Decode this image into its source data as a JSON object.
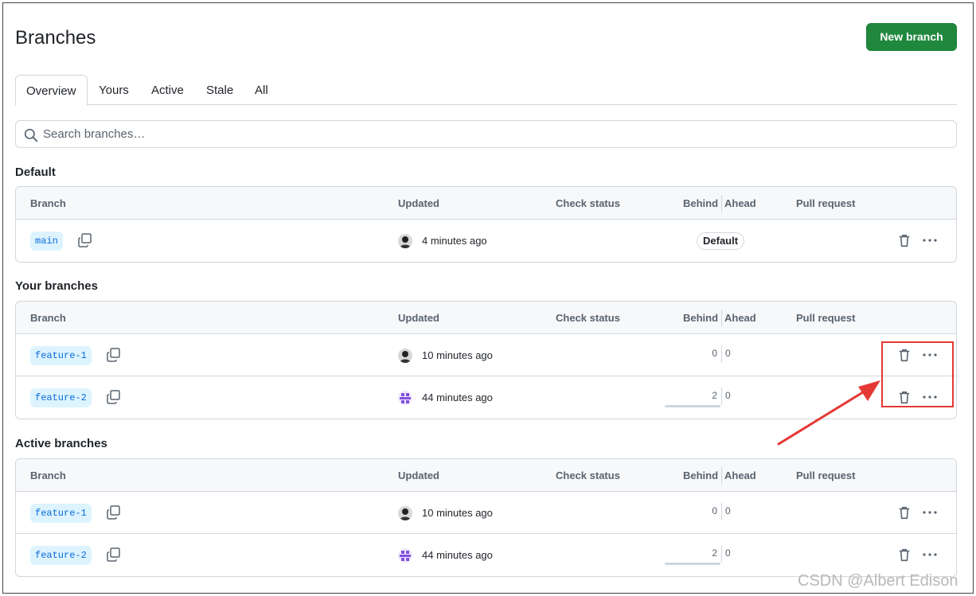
{
  "header": {
    "title": "Branches",
    "new_branch_label": "New branch"
  },
  "tabs": [
    {
      "label": "Overview",
      "selected": true
    },
    {
      "label": "Yours",
      "selected": false
    },
    {
      "label": "Active",
      "selected": false
    },
    {
      "label": "Stale",
      "selected": false
    },
    {
      "label": "All",
      "selected": false
    }
  ],
  "search": {
    "placeholder": "Search branches…",
    "value": ""
  },
  "columns": {
    "branch": "Branch",
    "updated": "Updated",
    "check_status": "Check status",
    "behind": "Behind",
    "ahead": "Ahead",
    "pull_request": "Pull request"
  },
  "sections": {
    "default": {
      "title": "Default",
      "rows": [
        {
          "branch": "main",
          "updated": "4 minutes ago",
          "badge": "Default"
        }
      ]
    },
    "yours": {
      "title": "Your branches",
      "rows": [
        {
          "branch": "feature-1",
          "updated": "10 minutes ago",
          "behind": "0",
          "ahead": "0"
        },
        {
          "branch": "feature-2",
          "updated": "44 minutes ago",
          "behind": "2",
          "ahead": "0"
        }
      ]
    },
    "active": {
      "title": "Active branches",
      "rows": [
        {
          "branch": "feature-1",
          "updated": "10 minutes ago",
          "behind": "0",
          "ahead": "0"
        },
        {
          "branch": "feature-2",
          "updated": "44 minutes ago",
          "behind": "2",
          "ahead": "0"
        }
      ]
    }
  },
  "icons": {
    "search": "search-icon",
    "copy": "copy-icon",
    "trash": "trash-icon",
    "kebab": "kebab-horizontal-icon"
  },
  "colors": {
    "primary_button": "#1f883d",
    "branch_pill_bg": "#ddf4ff",
    "branch_pill_text": "#0969da",
    "annotation": "#e53935"
  },
  "watermark": "CSDN @Albert Edison"
}
